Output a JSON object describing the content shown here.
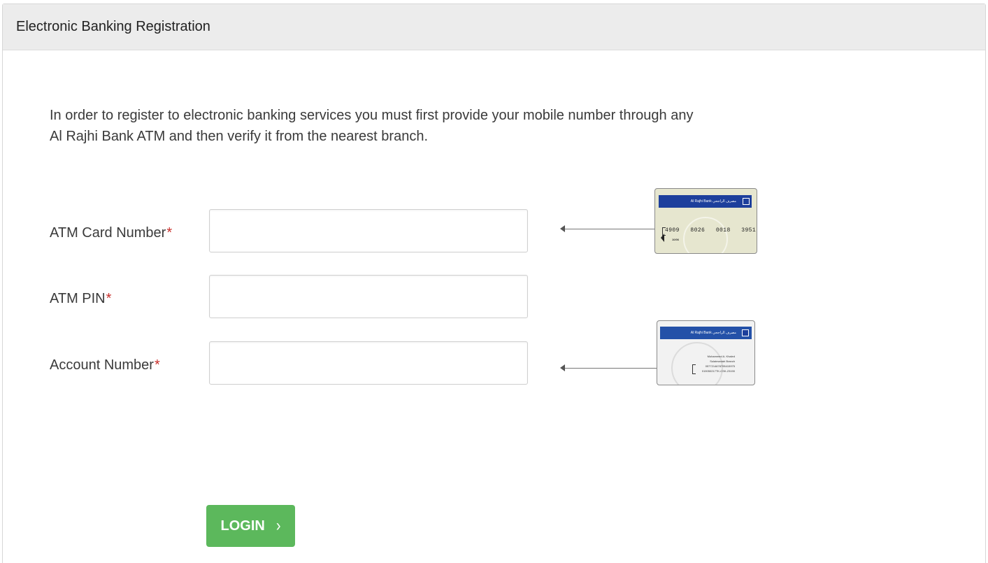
{
  "header": {
    "title": "Electronic Banking Registration"
  },
  "intro": {
    "line1": "In order to register to electronic banking services you must first provide your mobile number through any",
    "line2": "Al Rajhi Bank ATM and then verify it from the nearest branch."
  },
  "form": {
    "required_marker": "*",
    "fields": [
      {
        "label": "ATM Card Number",
        "value": "",
        "placeholder": ""
      },
      {
        "label": "ATM PIN",
        "value": "",
        "placeholder": ""
      },
      {
        "label": "Account Number",
        "value": "",
        "placeholder": ""
      }
    ]
  },
  "card_front": {
    "bank_name": "Al Rajhi Bank مصرف الراجحي",
    "number_groups": [
      "4909",
      "8026",
      "0018",
      "3951"
    ],
    "valid_text": "10/06"
  },
  "card_back": {
    "bank_name": "Al Rajhi Bank مصرف الراجحي",
    "holder_lines": [
      "Mohammed A. Khaled",
      "Sulaimaniah Branch",
      "0577214678795415975",
      "019050217TK-CSK-23190"
    ]
  },
  "actions": {
    "login_label": "LOGIN",
    "login_icon": "chevron-right-icon"
  },
  "colors": {
    "header_bg": "#ececec",
    "required": "#c9302c",
    "login_button": "#5cb85c",
    "card_band": "#1d3f9c"
  }
}
